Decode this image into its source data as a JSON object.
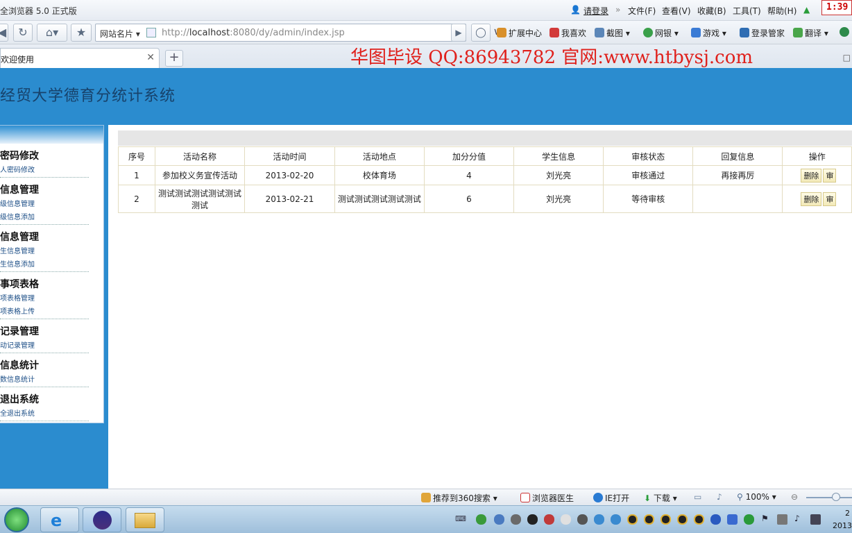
{
  "browser": {
    "title": "全浏览器 5.0 正式版",
    "login": "请登录",
    "menus": [
      "文件(F)",
      "查看(V)",
      "收藏(B)",
      "工具(T)",
      "帮助(H)"
    ],
    "clock": "1:39",
    "site_card": "网站名片",
    "url_prefix": "http://",
    "url_host": "localhost",
    "url_rest": ":8080/dy/admin/index.jsp",
    "toolbar": [
      "扩展中心",
      "我喜欢",
      "截图",
      "网银",
      "游戏",
      "登录管家",
      "翻译"
    ],
    "tab_label": "欢迎使用",
    "watermark": "华图毕设 QQ:86943782 官网:www.htbysj.com"
  },
  "page": {
    "system_title": "经贸大学德育分统计系统",
    "sidebar": [
      {
        "title": "密码修改",
        "links": [
          "人密码修改"
        ]
      },
      {
        "title": "信息管理",
        "links": [
          "级信息管理",
          "级信息添加"
        ]
      },
      {
        "title": "信息管理",
        "links": [
          "生信息管理",
          "生信息添加"
        ]
      },
      {
        "title": "事项表格",
        "links": [
          "项表格管理",
          "项表格上传"
        ]
      },
      {
        "title": "记录管理",
        "links": [
          "动记录管理"
        ]
      },
      {
        "title": "信息统计",
        "links": [
          "数信息统计"
        ]
      },
      {
        "title": "退出系统",
        "links": [
          "全退出系统"
        ]
      }
    ],
    "table": {
      "headers": [
        "序号",
        "活动名称",
        "活动时间",
        "活动地点",
        "加分分值",
        "学生信息",
        "审核状态",
        "回复信息",
        "操作"
      ],
      "rows": [
        [
          "1",
          "参加校义务宣传活动",
          "2013-02-20",
          "校体育场",
          "4",
          "刘光亮",
          "审核通过",
          "再接再厉"
        ],
        [
          "2",
          "测试测试测试测试测试测试",
          "2013-02-21",
          "测试测试测试测试测试",
          "6",
          "刘光亮",
          "等待审核",
          ""
        ]
      ],
      "delete_label": "删除",
      "audit_label": "审"
    }
  },
  "statusbar": {
    "recommend": "推荐到360搜索",
    "doctor": "浏览器医生",
    "ie_open": "IE打开",
    "download": "下载",
    "zoom": "100%"
  },
  "taskbar": {
    "clock_top": "2",
    "clock_bottom": "2013"
  }
}
